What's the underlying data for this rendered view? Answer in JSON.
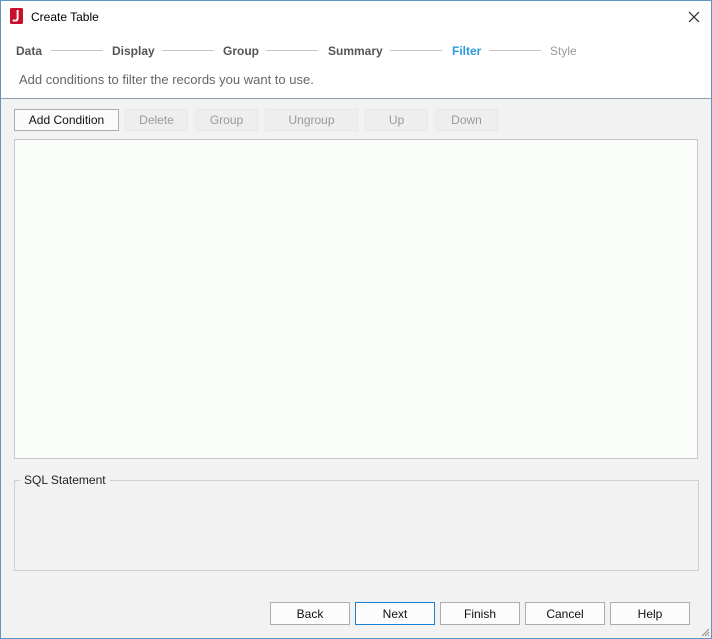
{
  "window": {
    "title": "Create Table",
    "icons": {
      "app": "app-logo-icon",
      "close": "close-icon",
      "grip": "resize-grip-icon"
    },
    "colors": {
      "border": "#5f95c6",
      "active_step": "#2c9be0",
      "logo": "#c8102e"
    }
  },
  "wizard": {
    "steps": [
      {
        "label": "Data",
        "state": "completed"
      },
      {
        "label": "Display",
        "state": "completed"
      },
      {
        "label": "Group",
        "state": "completed"
      },
      {
        "label": "Summary",
        "state": "completed"
      },
      {
        "label": "Filter",
        "state": "active"
      },
      {
        "label": "Style",
        "state": "future"
      }
    ],
    "hint": "Add conditions to filter the records you want to use."
  },
  "toolbar": {
    "buttons": [
      {
        "label": "Add Condition",
        "enabled": true
      },
      {
        "label": "Delete",
        "enabled": false
      },
      {
        "label": "Group",
        "enabled": false
      },
      {
        "label": "Ungroup",
        "enabled": false
      },
      {
        "label": "Up",
        "enabled": false
      },
      {
        "label": "Down",
        "enabled": false
      }
    ]
  },
  "sql": {
    "legend": "SQL Statement",
    "text": ""
  },
  "footer": {
    "buttons": [
      {
        "label": "Back",
        "default": false
      },
      {
        "label": "Next",
        "default": true
      },
      {
        "label": "Finish",
        "default": false
      },
      {
        "label": "Cancel",
        "default": false
      },
      {
        "label": "Help",
        "default": false
      }
    ]
  }
}
